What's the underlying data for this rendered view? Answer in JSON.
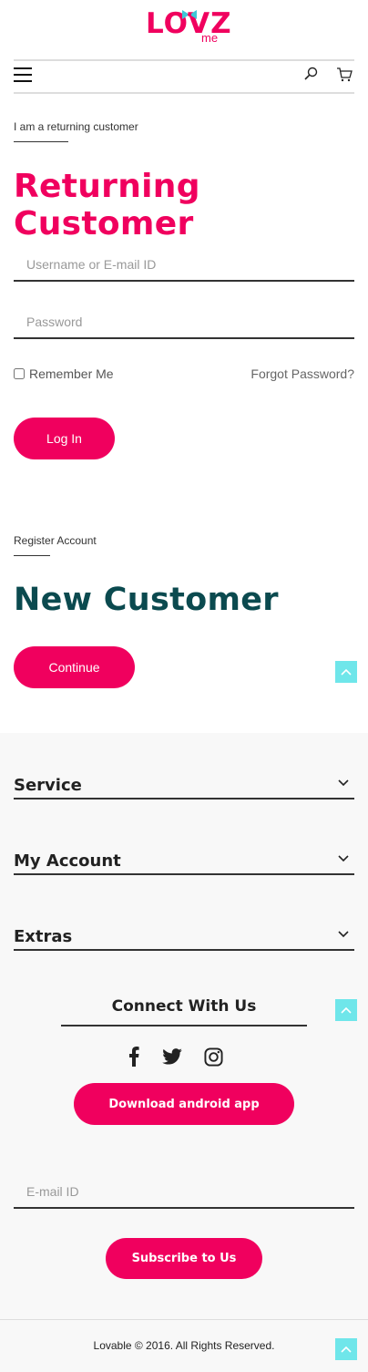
{
  "brand": {
    "logo_main": "LOVZ",
    "logo_sub": "me",
    "accent_color": "#f0005e"
  },
  "login": {
    "breadcrumb": "I am a returning customer",
    "title": "Returning Customer",
    "username_placeholder": "Username or E-mail ID",
    "password_placeholder": "Password",
    "remember_label": "Remember Me",
    "forgot_label": "Forgot Password?",
    "login_button": "Log In"
  },
  "register": {
    "breadcrumb": "Register Account",
    "title": "New Customer",
    "continue_button": "Continue"
  },
  "footer": {
    "sections": [
      "Service",
      "My Account",
      "Extras"
    ],
    "connect_title": "Connect With Us",
    "social": [
      "facebook-icon",
      "twitter-icon",
      "instagram-icon"
    ],
    "android_button": "Download android app",
    "email_placeholder": "E-mail ID",
    "subscribe_button": "Subscribe to Us",
    "copyright": "Lovable © 2016. All Rights Reserved."
  },
  "icons": {
    "menu": "hamburger-menu-icon",
    "search": "search-icon",
    "cart": "cart-icon",
    "scroll_top": "chevron-up-icon",
    "accordion": "chevron-down-icon"
  }
}
